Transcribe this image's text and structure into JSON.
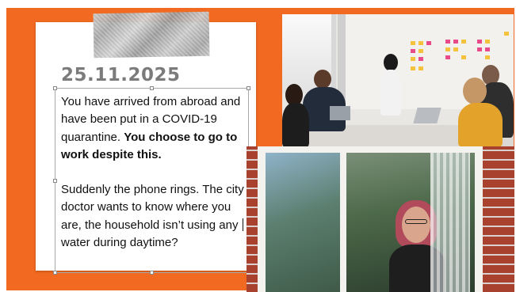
{
  "slide": {
    "date": "25.11.2025",
    "paragraph1_normal": "You have arrived from abroad and have been put in a COVID-19 quarantine. ",
    "paragraph1_bold": "You choose to go to work despite this.",
    "paragraph2_before_cursor": "Suddenly the phone rings. The city doctor wants to know where you are, the household isn’t using any",
    "paragraph2_after_cursor": "water during daytime?"
  },
  "colors": {
    "slide_background": "#f26a21",
    "date_text": "#7b7b7b",
    "body_text": "#111111"
  },
  "images": {
    "photo1": "office-meeting-photo",
    "photo2": "woman-at-window-photo",
    "decoration": "masking-tape"
  }
}
